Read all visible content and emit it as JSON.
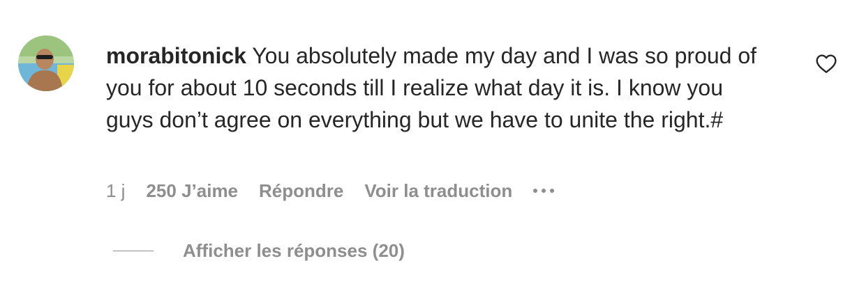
{
  "comment": {
    "username": "morabitonick",
    "text": "You absolutely made my day and I was so proud of you for about 10 seconds till I realize what day it is. I know you guys don’t agree on everything but we have to unite the right.#",
    "time": "1 j",
    "likes": "250 J’aime",
    "reply_label": "Répondre",
    "translate_label": "Voir la traduction",
    "more_icon": "more-dots-icon",
    "like_icon": "heart-icon",
    "avatar_alt": "avatar"
  },
  "replies": {
    "label": "Afficher les réponses (20)"
  },
  "colors": {
    "text": "#262626",
    "secondary": "#8e8e8e",
    "background": "#ffffff"
  }
}
